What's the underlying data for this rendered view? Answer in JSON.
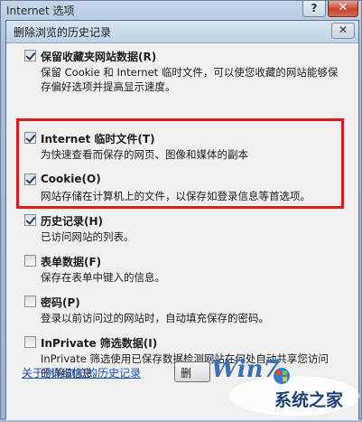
{
  "outer_window": {
    "title": "Internet 选项",
    "help_label": "?",
    "close_label": "✕"
  },
  "dialog": {
    "title": "删除浏览的历史记录",
    "close_label": "✕"
  },
  "options": [
    {
      "label": "保留收藏夹网站数据(R)",
      "checked": true,
      "desc": "保留 Cookie 和 Internet 临时文件，可以使您收藏的网站能够保存偏好选项并提高显示速度。"
    },
    {
      "label": "Internet 临时文件(T)",
      "checked": true,
      "desc": "为快速查看而保存的网页、图像和媒体的副本"
    },
    {
      "label": "Cookie(O)",
      "checked": true,
      "desc": "网站存储在计算机上的文件，以保存如登录信息等首选项。"
    },
    {
      "label": "历史记录(H)",
      "checked": true,
      "desc": "已访问网站的列表。"
    },
    {
      "label": "表单数据(F)",
      "checked": false,
      "desc": "保存在表单中键入的信息。"
    },
    {
      "label": "密码(P)",
      "checked": false,
      "desc": "登录以前访问过的网站时，自动填充保存的密码。"
    },
    {
      "label": "InPrivate 筛选数据(I)",
      "checked": false,
      "desc": "InPrivate 筛选使用已保存数据检测网站在何处自动共享您访问的详细信息。"
    }
  ],
  "footer": {
    "link": "关于删除浏览的历史记录",
    "delete_button_label": "删"
  },
  "watermark": {
    "brand": "Win7",
    "site": "系统之家"
  },
  "colors": {
    "highlight_box": "#e01b1b",
    "link": "#1a55b8"
  }
}
